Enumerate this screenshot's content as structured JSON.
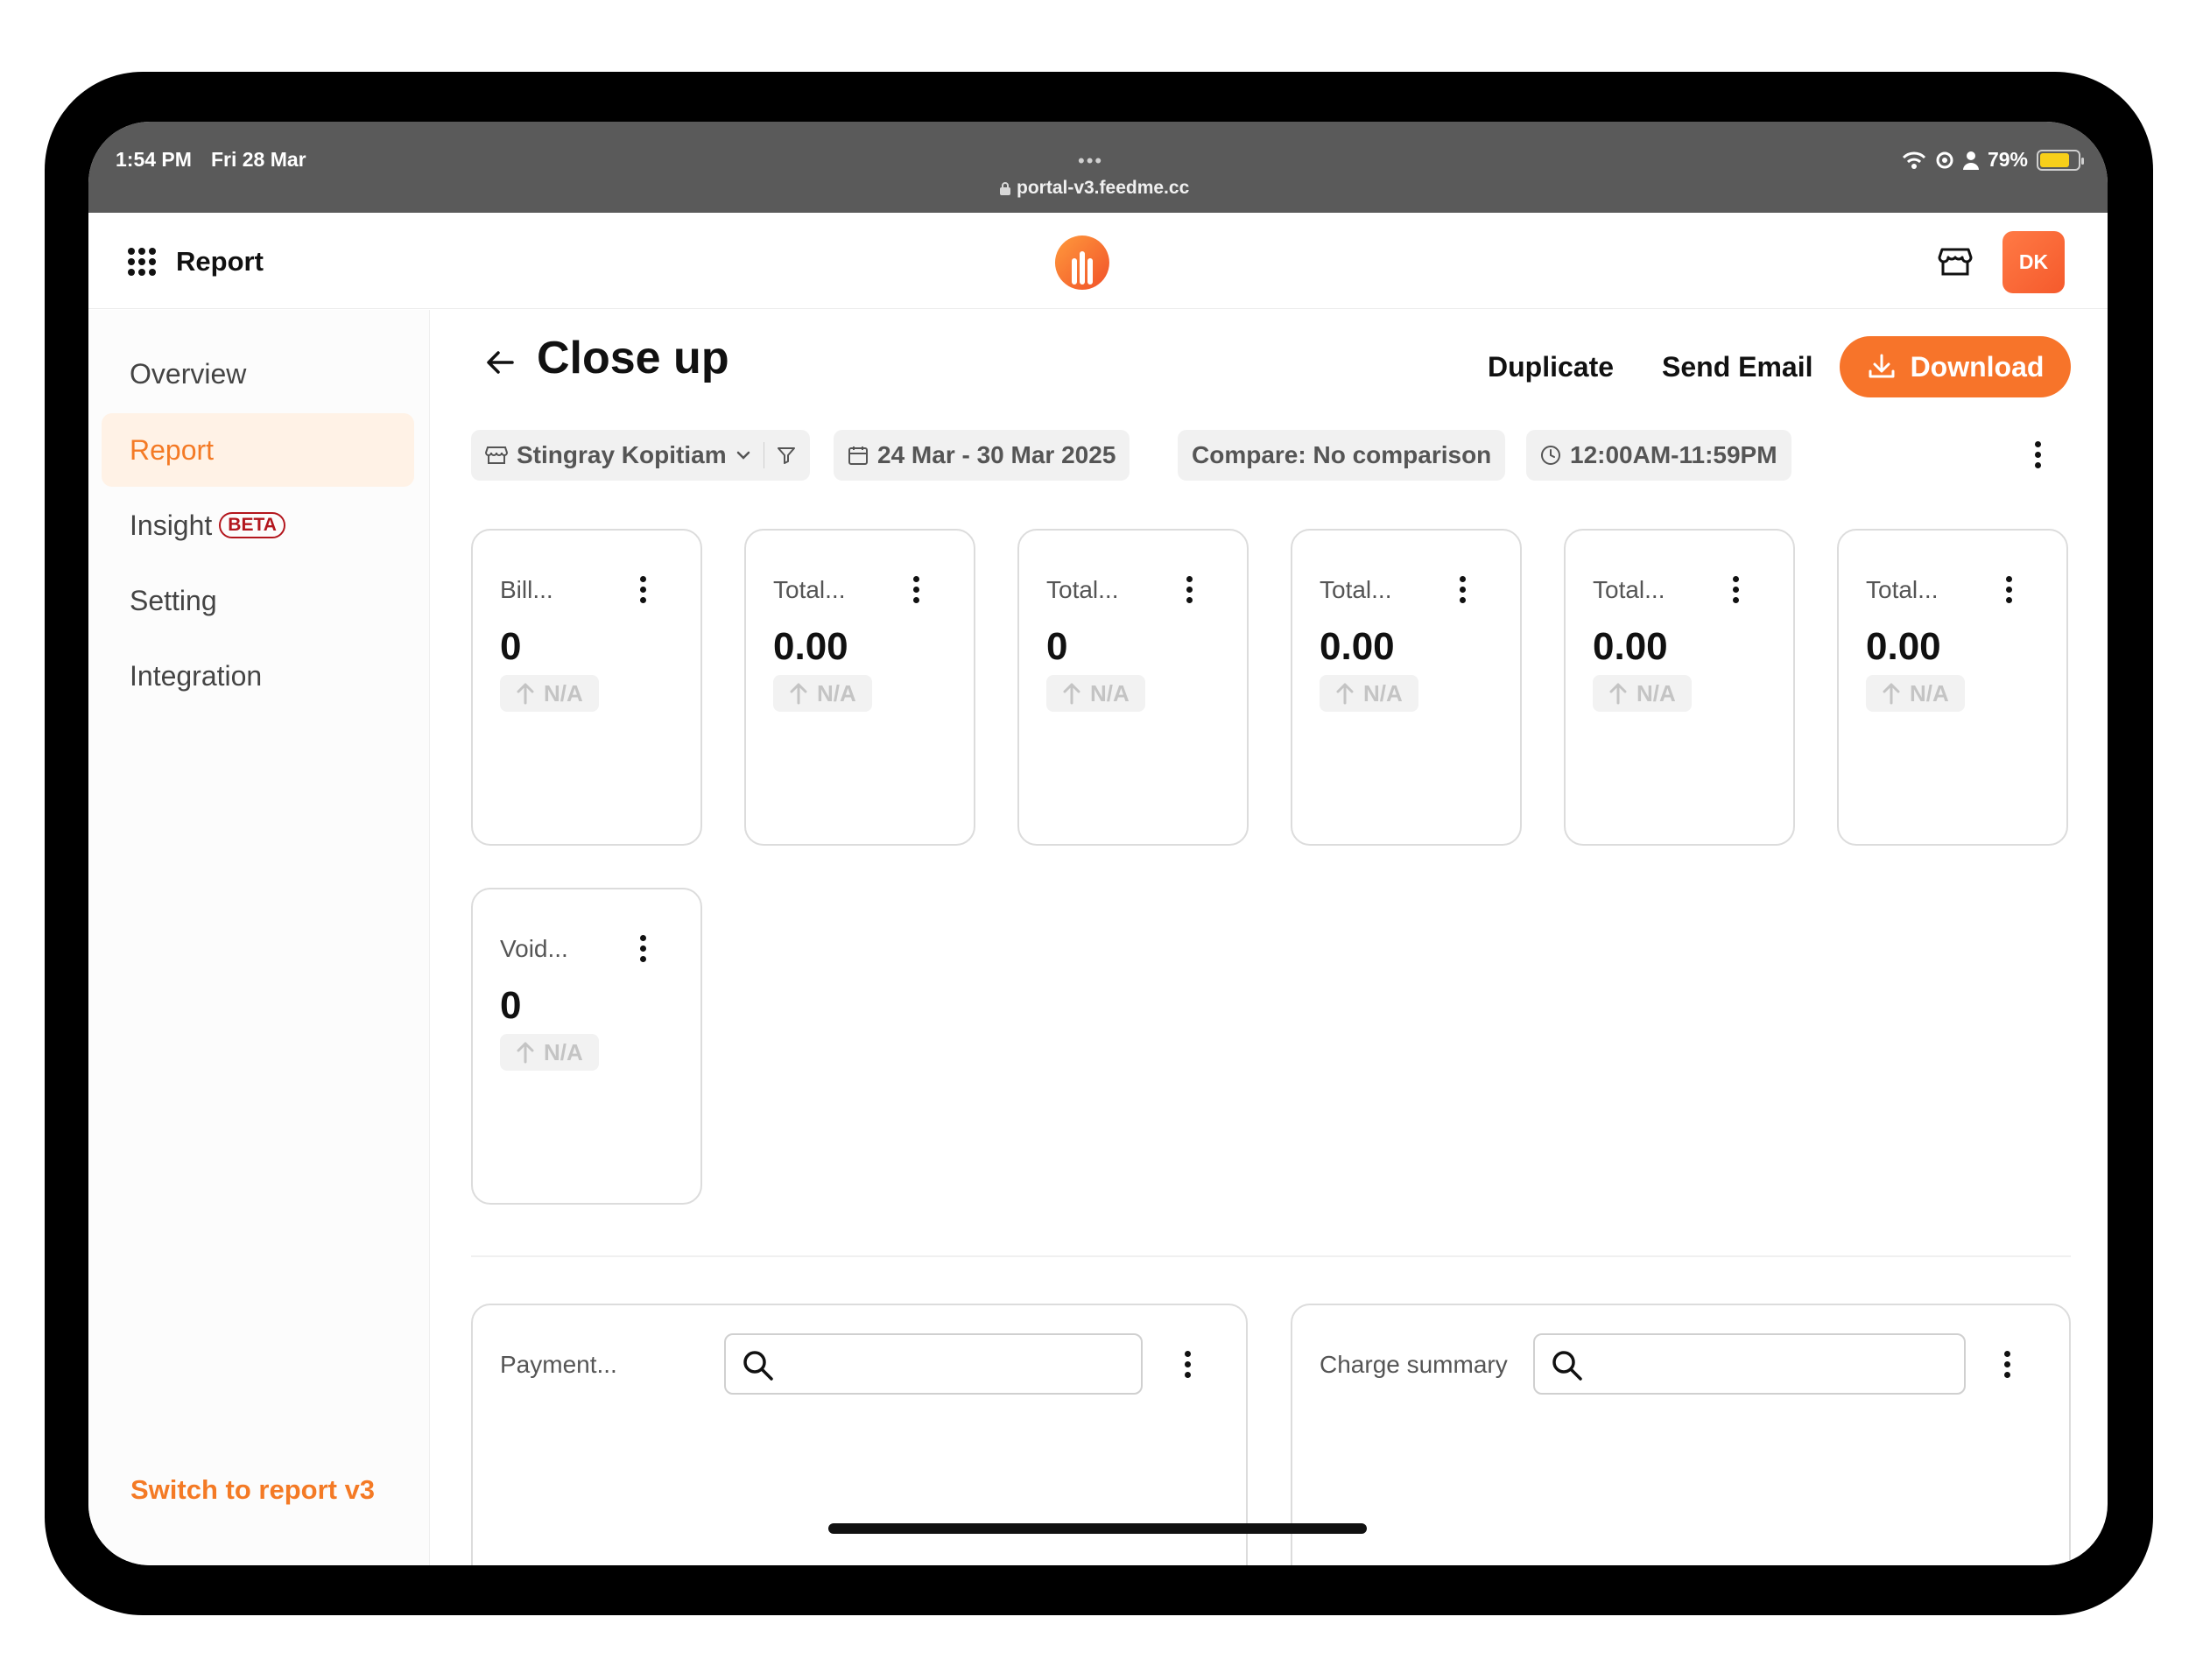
{
  "status_bar": {
    "time": "1:54 PM",
    "date": "Fri 28 Mar",
    "dots": "•••",
    "url": "portal-v3.feedme.cc",
    "battery": "79%",
    "battery_level": 0.79
  },
  "header": {
    "title": "Report",
    "avatar_initials": "DK"
  },
  "sidebar": {
    "items": [
      {
        "label": "Overview"
      },
      {
        "label": "Report"
      },
      {
        "label": "Insight",
        "badge": "BETA"
      },
      {
        "label": "Setting"
      },
      {
        "label": "Integration"
      }
    ],
    "switch_link": "Switch to report v3"
  },
  "page": {
    "title": "Close up",
    "duplicate_label": "Duplicate",
    "send_email_label": "Send Email",
    "download_label": "Download"
  },
  "filters": {
    "store": "Stingray Kopitiam",
    "date_range": "24 Mar - 30 Mar 2025",
    "compare": "Compare: No comparison",
    "time_range": "12:00AM-11:59PM"
  },
  "cards": [
    {
      "title": "Bill...",
      "value": "0",
      "change": "N/A"
    },
    {
      "title": "Total...",
      "value": "0.00",
      "change": "N/A"
    },
    {
      "title": "Total...",
      "value": "0",
      "change": "N/A"
    },
    {
      "title": "Total...",
      "value": "0.00",
      "change": "N/A"
    },
    {
      "title": "Total...",
      "value": "0.00",
      "change": "N/A"
    },
    {
      "title": "Total...",
      "value": "0.00",
      "change": "N/A"
    },
    {
      "title": "Void...",
      "value": "0",
      "change": "N/A"
    }
  ],
  "panels": [
    {
      "title": "Payment..."
    },
    {
      "title": "Charge summary"
    }
  ],
  "colors": {
    "accent": "#f7742a",
    "active_bg": "#fff2e6",
    "beta": "#b3161d",
    "status_bar": "#5a5a5a"
  }
}
